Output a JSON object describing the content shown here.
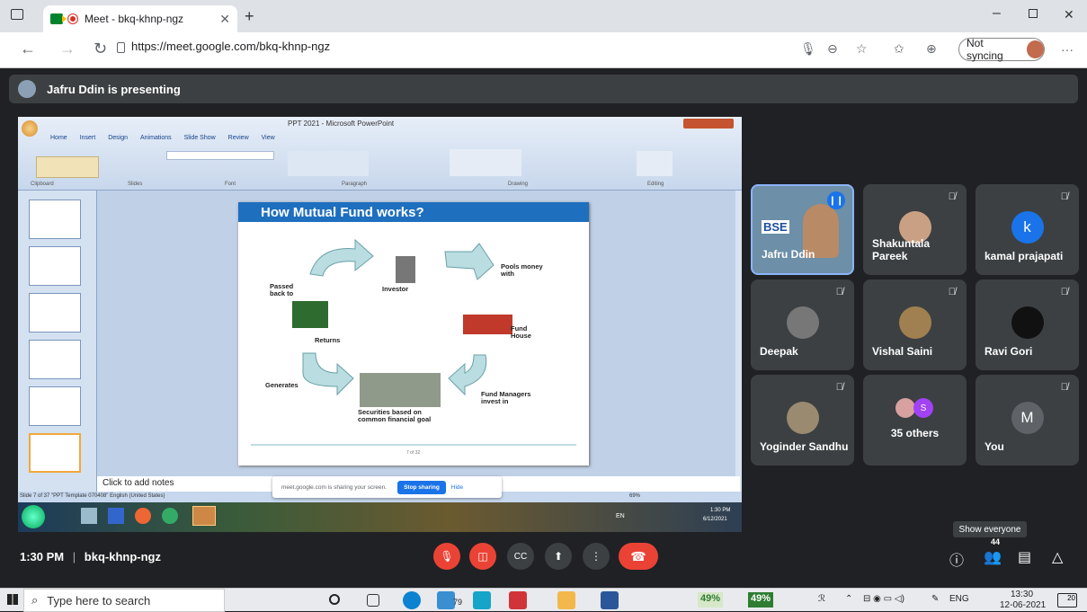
{
  "browser": {
    "tab_title": "Meet - bkq-khnp-ngz",
    "url": "https://meet.google.com/bkq-khnp-ngz",
    "sync_label": "Not syncing",
    "more_label": "···"
  },
  "meet": {
    "presenter_banner": "Jafru Ddin is presenting",
    "time": "1:30 PM",
    "separator": "|",
    "meeting_code": "bkq-khnp-ngz",
    "tooltip": "Show everyone",
    "people_count": "44"
  },
  "shared_screen": {
    "window_title": "PPT 2021 - Microsoft PowerPoint",
    "ribbon_tabs": [
      "Home",
      "Insert",
      "Design",
      "Animations",
      "Slide Show",
      "Review",
      "View"
    ],
    "ribbon_groups": [
      "Clipboard",
      "Slides",
      "Font",
      "Paragraph",
      "Drawing",
      "Editing"
    ],
    "slide_title": "How Mutual Fund works?",
    "slide_labels": {
      "investor": "Investor",
      "pools": "Pools money with",
      "fund_house": "Fund House",
      "managers": "Fund Managers invest in",
      "securities": "Securities based on common financial goal",
      "generates": "Generates",
      "returns": "Returns",
      "passed": "Passed back to"
    },
    "slide_footer": "7 of 32",
    "notes_placeholder": "Click to add notes",
    "status_text": "Slide 7 of 37   \"PPT Template 070408\"   English (United States)",
    "zoom": "69%",
    "sharing_msg": "meet.google.com is sharing your screen.",
    "stop_sharing": "Stop sharing",
    "hide": "Hide",
    "task_lang": "EN",
    "task_time": "1:30 PM",
    "task_date": "6/12/2021"
  },
  "participants": [
    {
      "name": "Jafru Ddin"
    },
    {
      "name": "Shakuntala Pareek"
    },
    {
      "name": "kamal prajapati",
      "initial": "k"
    },
    {
      "name": "Deepak"
    },
    {
      "name": "Vishal Saini"
    },
    {
      "name": "Ravi Gori"
    },
    {
      "name": "Yoginder Sandhu"
    },
    {
      "name": "35 others",
      "initial": "S"
    },
    {
      "name": "You",
      "initial": "M"
    }
  ],
  "taskbar": {
    "search_placeholder": "Type here to search",
    "badge_79": "79",
    "battery1": "49%",
    "battery2": "49%",
    "lang": "ENG",
    "time": "13:30",
    "date": "12-06-2021",
    "notif": "20"
  },
  "colors": {
    "meet_bg": "#202124",
    "tile_bg": "#3c4043",
    "danger": "#ea4335",
    "accent": "#1a73e8"
  }
}
